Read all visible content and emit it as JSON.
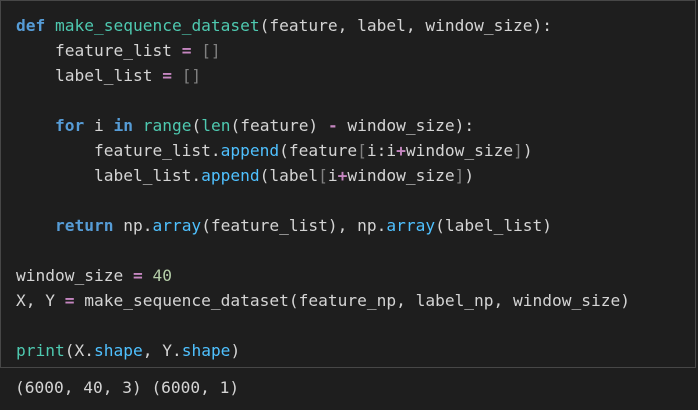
{
  "code_lines": [
    {
      "tokens": [
        {
          "t": "def",
          "c": "kw"
        },
        {
          "t": " ",
          "c": "pl"
        },
        {
          "t": "make_sequence_dataset",
          "c": "fn"
        },
        {
          "t": "(feature, label, window_size):",
          "c": "pl"
        }
      ]
    },
    {
      "tokens": [
        {
          "t": "    feature_list ",
          "c": "pl"
        },
        {
          "t": "=",
          "c": "op"
        },
        {
          "t": " ",
          "c": "pl"
        },
        {
          "t": "[]",
          "c": "br"
        }
      ]
    },
    {
      "tokens": [
        {
          "t": "    label_list ",
          "c": "pl"
        },
        {
          "t": "=",
          "c": "op"
        },
        {
          "t": " ",
          "c": "pl"
        },
        {
          "t": "[]",
          "c": "br"
        }
      ]
    },
    {
      "tokens": []
    },
    {
      "tokens": [
        {
          "t": "    ",
          "c": "pl"
        },
        {
          "t": "for",
          "c": "kw"
        },
        {
          "t": " i ",
          "c": "pl"
        },
        {
          "t": "in",
          "c": "kw"
        },
        {
          "t": " ",
          "c": "pl"
        },
        {
          "t": "range",
          "c": "bi"
        },
        {
          "t": "(",
          "c": "pl"
        },
        {
          "t": "len",
          "c": "bi"
        },
        {
          "t": "(feature) ",
          "c": "pl"
        },
        {
          "t": "-",
          "c": "op"
        },
        {
          "t": " window_size):",
          "c": "pl"
        }
      ]
    },
    {
      "tokens": [
        {
          "t": "        feature_list.",
          "c": "pl"
        },
        {
          "t": "append",
          "c": "mt"
        },
        {
          "t": "(feature",
          "c": "pl"
        },
        {
          "t": "[",
          "c": "br"
        },
        {
          "t": "i:i",
          "c": "pl"
        },
        {
          "t": "+",
          "c": "op"
        },
        {
          "t": "window_size",
          "c": "pl"
        },
        {
          "t": "]",
          "c": "br"
        },
        {
          "t": ")",
          "c": "pl"
        }
      ]
    },
    {
      "tokens": [
        {
          "t": "        label_list.",
          "c": "pl"
        },
        {
          "t": "append",
          "c": "mt"
        },
        {
          "t": "(label",
          "c": "pl"
        },
        {
          "t": "[",
          "c": "br"
        },
        {
          "t": "i",
          "c": "pl"
        },
        {
          "t": "+",
          "c": "op"
        },
        {
          "t": "window_size",
          "c": "pl"
        },
        {
          "t": "]",
          "c": "br"
        },
        {
          "t": ")",
          "c": "pl"
        }
      ]
    },
    {
      "tokens": []
    },
    {
      "tokens": [
        {
          "t": "    ",
          "c": "pl"
        },
        {
          "t": "return",
          "c": "kw"
        },
        {
          "t": " np.",
          "c": "pl"
        },
        {
          "t": "array",
          "c": "mt"
        },
        {
          "t": "(feature_list), np.",
          "c": "pl"
        },
        {
          "t": "array",
          "c": "mt"
        },
        {
          "t": "(label_list)",
          "c": "pl"
        }
      ]
    },
    {
      "tokens": []
    },
    {
      "tokens": [
        {
          "t": "window_size ",
          "c": "pl"
        },
        {
          "t": "=",
          "c": "op"
        },
        {
          "t": " ",
          "c": "pl"
        },
        {
          "t": "40",
          "c": "num"
        }
      ]
    },
    {
      "tokens": [
        {
          "t": "X, Y ",
          "c": "pl"
        },
        {
          "t": "=",
          "c": "op"
        },
        {
          "t": " make_sequence_dataset(feature_np, label_np, window_size)",
          "c": "pl"
        }
      ]
    },
    {
      "tokens": []
    },
    {
      "tokens": [
        {
          "t": "print",
          "c": "bi"
        },
        {
          "t": "(X.",
          "c": "pl"
        },
        {
          "t": "shape",
          "c": "mt"
        },
        {
          "t": ", Y.",
          "c": "pl"
        },
        {
          "t": "shape",
          "c": "mt"
        },
        {
          "t": ")",
          "c": "pl"
        }
      ]
    }
  ],
  "output_text": "(6000, 40, 3) (6000, 1)",
  "colors": {
    "background": "#1e1e1e",
    "keyword": "#569cd6",
    "function_name": "#4ec9b0",
    "method": "#4fc1ff",
    "operator": "#c586c0",
    "number": "#b5cea8",
    "plain": "#d4d4d4"
  }
}
